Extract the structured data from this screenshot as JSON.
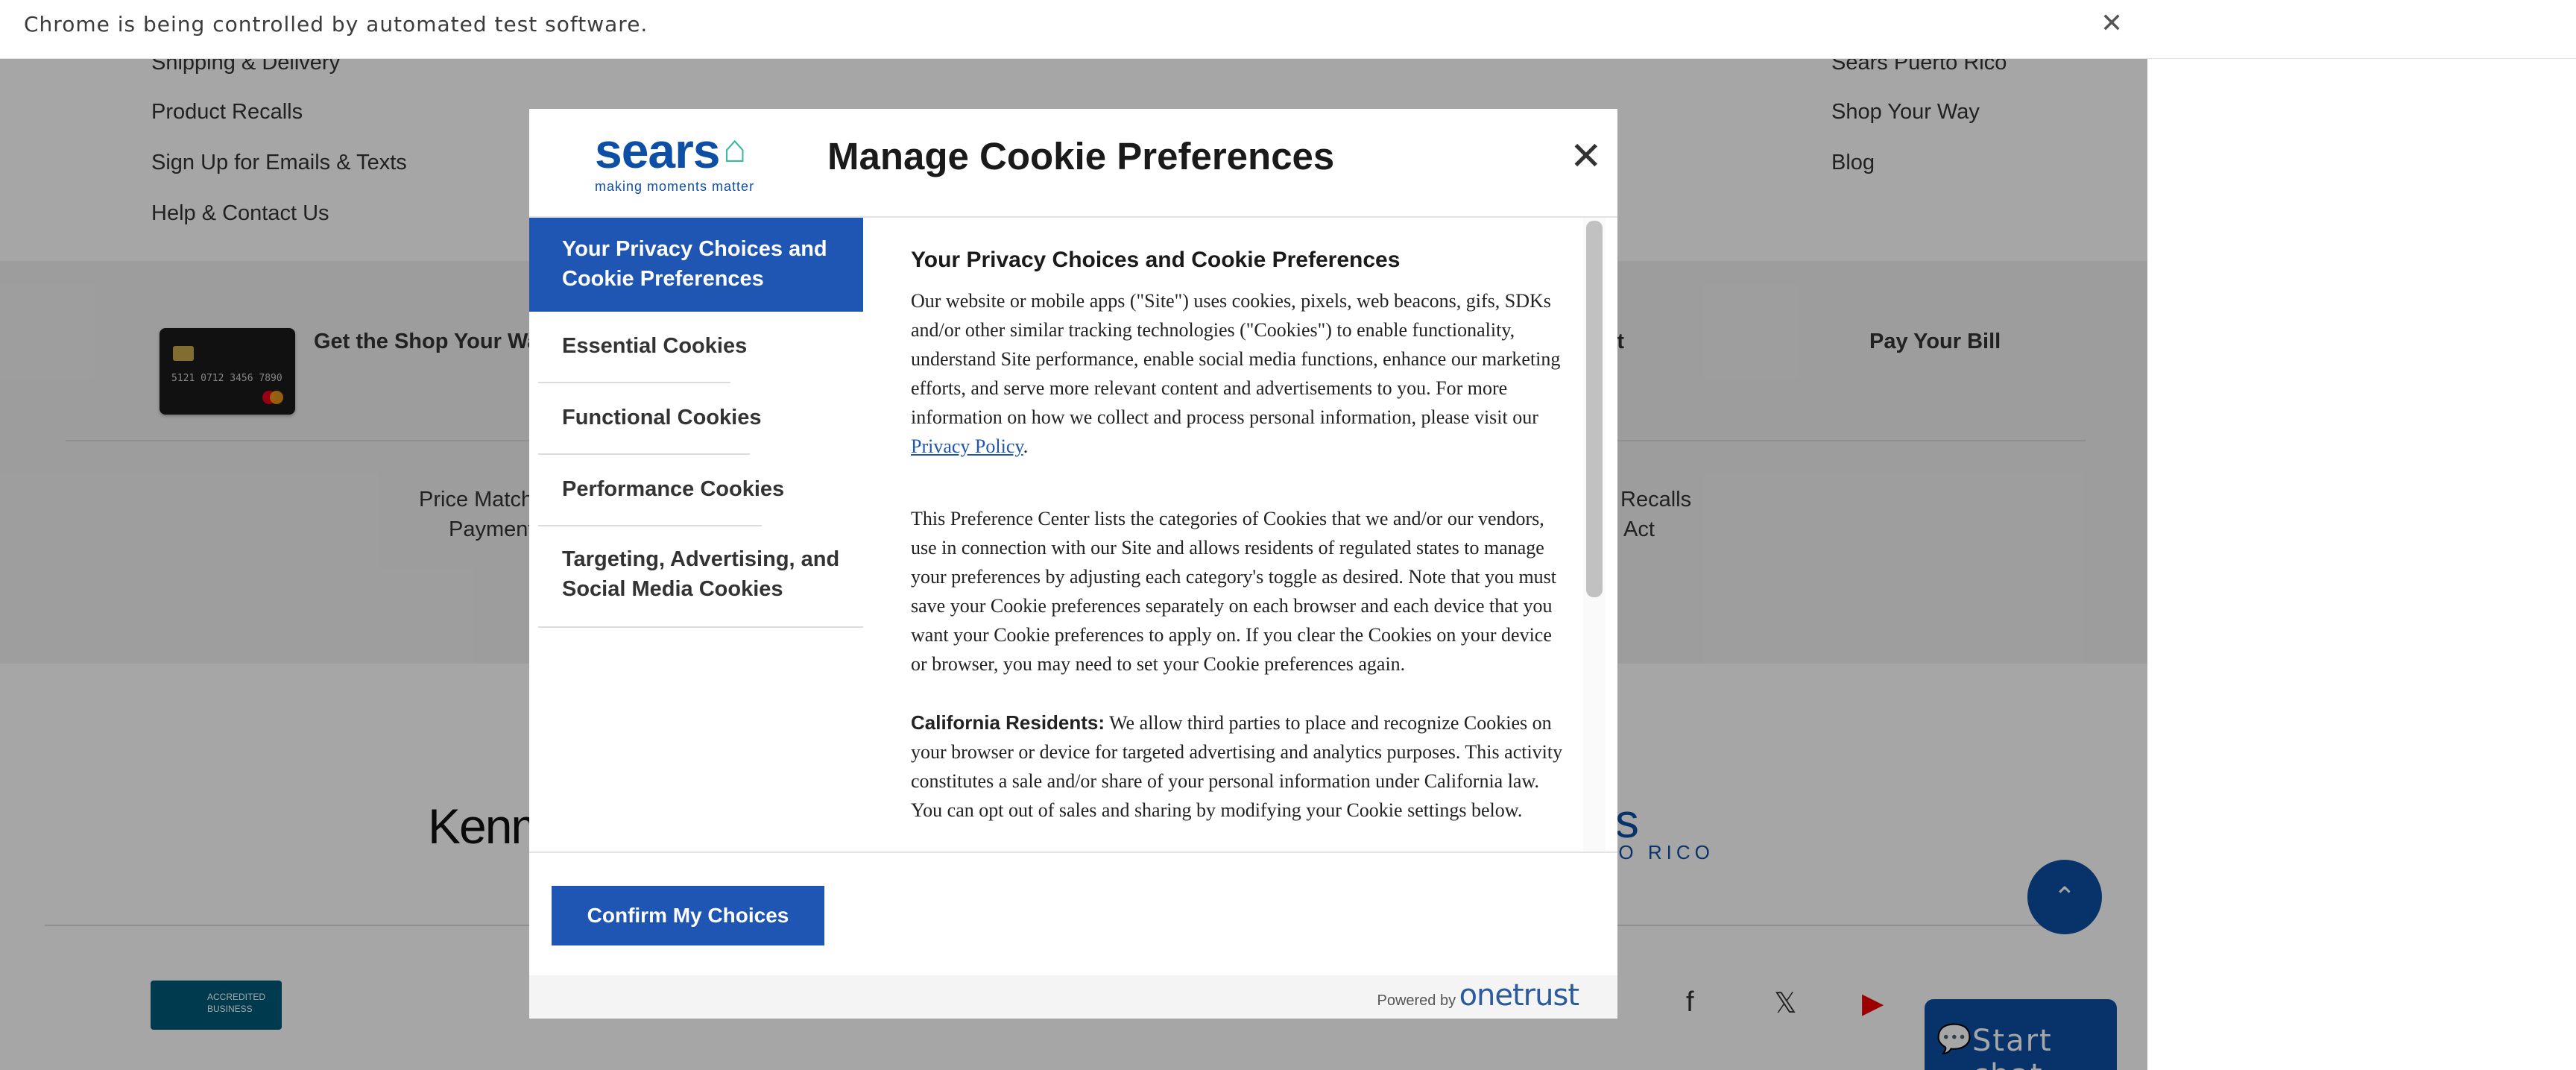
{
  "browser": {
    "infobar_message": "Chrome is being controlled by automated test software.",
    "close_glyph": "✕"
  },
  "background_page": {
    "footer_links_left": [
      "Shipping & Delivery",
      "Product Recalls",
      "Sign Up for Emails & Texts",
      "Help & Contact Us"
    ],
    "footer_links_right": [
      "Sears Puerto Rico",
      "Shop Your Way",
      "Blog"
    ],
    "band_links": [
      "Get the Shop Your Way",
      "unt",
      "Pay Your Bill"
    ],
    "lower_links": [
      "Price Match",
      "Payment",
      "Recalls",
      "Act"
    ],
    "brand_logos": {
      "kenmore": "Kenm",
      "sears_pr": "ars",
      "sears_pr_sub": "TO RICO"
    },
    "bbb_label": "ACCREDITED BUSINESS",
    "chat_label": "Start chat",
    "scroll_top_glyph": "⌃"
  },
  "modal": {
    "logo": {
      "word": "sears",
      "tagline": "making moments matter"
    },
    "title": "Manage Cookie Preferences",
    "close_glyph": "✕",
    "tabs": [
      {
        "label": "Your Privacy Choices and Cookie Preferences",
        "active": true
      },
      {
        "label": "Essential Cookies",
        "active": false
      },
      {
        "label": "Functional Cookies",
        "active": false
      },
      {
        "label": "Performance Cookies",
        "active": false
      },
      {
        "label": "Targeting, Advertising, and Social Media Cookies",
        "active": false
      }
    ],
    "content": {
      "heading": "Your Privacy Choices and Cookie Preferences",
      "para1": "Our website or mobile apps (\"Site\") uses cookies, pixels, web beacons, gifs, SDKs and/or other similar tracking technologies (\"Cookies\") to enable functionality, understand Site performance, enable social media functions, enhance our marketing efforts, and serve more relevant content and advertisements to you. For more information on how we collect and process personal information, please visit our ",
      "privacy_link": "Privacy Policy",
      "para1_end": ".",
      "para2": "This Preference Center lists the categories of Cookies that we and/or our vendors, use in connection with our Site and allows residents of regulated states to manage your preferences by adjusting each category's toggle as desired. Note that you must save your Cookie preferences separately on each browser and each device that you want your Cookie preferences to apply on. If you clear the Cookies on your device or browser, you may need to set your Cookie preferences again.",
      "para3_label": "California Residents:",
      "para3": " We allow third parties to place and recognize Cookies on your browser or device for targeted advertising and analytics purposes. This activity constitutes a sale and/or share of your personal information under California law. You can opt out of sales and sharing by modifying your Cookie settings below."
    },
    "confirm_label": "Confirm My Choices",
    "powered_by": "Powered by",
    "onetrust": "onetrust"
  },
  "colors": {
    "accent": "#1f55b3",
    "sears_blue": "#0d4fa4",
    "sears_teal": "#3bb8a0"
  }
}
